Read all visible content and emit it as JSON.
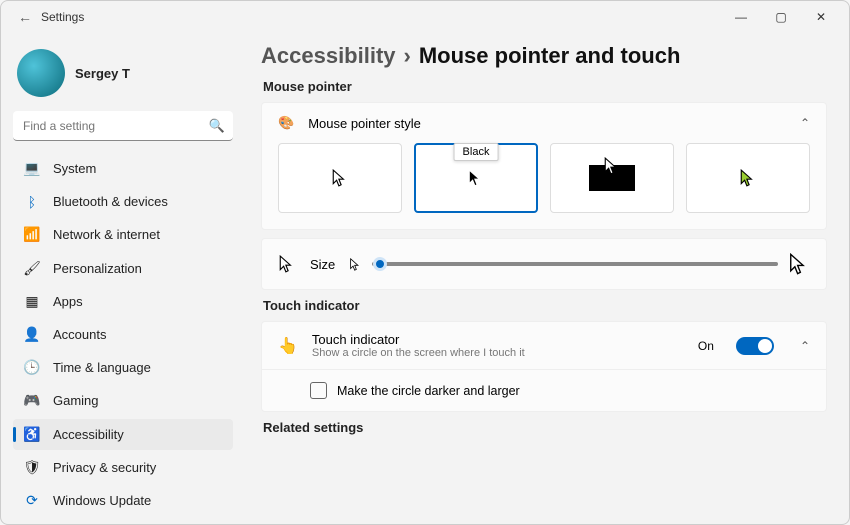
{
  "titlebar": {
    "title": "Settings"
  },
  "user": {
    "name": "Sergey T"
  },
  "search": {
    "placeholder": "Find a setting"
  },
  "nav": {
    "items": [
      {
        "label": "System",
        "icon": "💻"
      },
      {
        "label": "Bluetooth & devices",
        "icon": "ᛒ"
      },
      {
        "label": "Network & internet",
        "icon": "📶"
      },
      {
        "label": "Personalization",
        "icon": "🖌"
      },
      {
        "label": "Apps",
        "icon": "▦"
      },
      {
        "label": "Accounts",
        "icon": "👤"
      },
      {
        "label": "Time & language",
        "icon": "🕒"
      },
      {
        "label": "Gaming",
        "icon": "🎮"
      },
      {
        "label": "Accessibility",
        "icon": "♿"
      },
      {
        "label": "Privacy & security",
        "icon": "🛡"
      },
      {
        "label": "Windows Update",
        "icon": "⟳"
      }
    ],
    "selected": 8
  },
  "breadcrumb": {
    "parent": "Accessibility",
    "sep": "›",
    "current": "Mouse pointer and touch"
  },
  "sections": {
    "mouse_pointer": "Mouse pointer",
    "touch_indicator": "Touch indicator",
    "related": "Related settings"
  },
  "style_card": {
    "title": "Mouse pointer style",
    "tooltip": "Black"
  },
  "size_card": {
    "label": "Size"
  },
  "touch_card": {
    "title": "Touch indicator",
    "subtitle": "Show a circle on the screen where I touch it",
    "state": "On",
    "checkbox_label": "Make the circle darker and larger"
  }
}
